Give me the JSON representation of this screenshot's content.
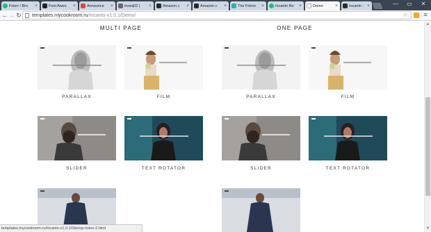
{
  "tabs": [
    {
      "label": "Fiverr / Bro",
      "favicon_color": "#1dbf73"
    },
    {
      "label": "Font Awes",
      "favicon_color": "#222222"
    },
    {
      "label": "Announce",
      "favicon_color": "#d94a38"
    },
    {
      "label": "evanj02 |",
      "favicon_color": "#6a6a6a"
    },
    {
      "label": "Amazon.c",
      "favicon_color": "#2b2b2b"
    },
    {
      "label": "Amazon.c",
      "favicon_color": "#2b2b2b"
    },
    {
      "label": "The Frienc",
      "favicon_color": "#2db0a8"
    },
    {
      "label": "Incanto Re",
      "favicon_color": "#1dbf73"
    },
    {
      "label": "Demo",
      "favicon_color": "#ffffff"
    },
    {
      "label": "Incanto -",
      "favicon_color": "#2b2b2b"
    }
  ],
  "toolbar": {
    "back_icon": "←",
    "forward_icon": "→",
    "reload_icon": "↻",
    "url_host": "templates.mycookroom.ru",
    "url_path": "/Incanto-v1.0.1/Demo/",
    "star_icon": "☆",
    "menu_icon": "≡"
  },
  "window_controls": {
    "minimize": "—",
    "maximize": "▭",
    "close": "✕"
  },
  "headings": {
    "multi": "MULTI PAGE",
    "one": "ONE PAGE"
  },
  "demos": [
    {
      "label": "PARALLAX"
    },
    {
      "label": "FILM"
    },
    {
      "label": "PARALLAX"
    },
    {
      "label": "FILM"
    },
    {
      "label": "SLIDER"
    },
    {
      "label": "TEXT ROTATOR"
    },
    {
      "label": "SLIDER"
    },
    {
      "label": "TEXT ROTATOR"
    }
  ],
  "status_url": "templates.mycookroom.ru/Incanto-v1.0.1/Site/op-index-2.html"
}
